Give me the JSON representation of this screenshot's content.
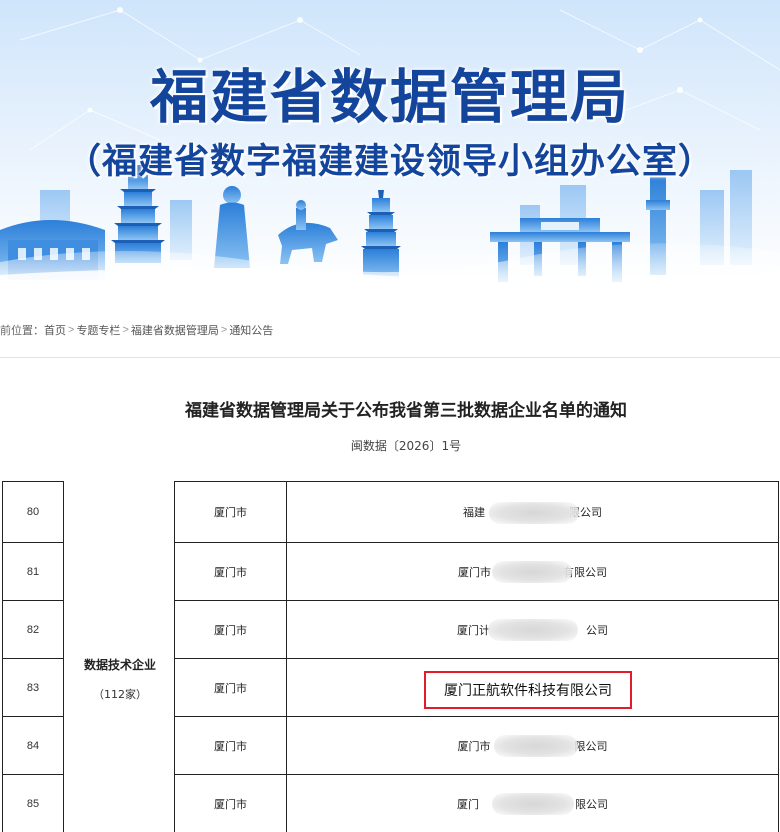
{
  "banner": {
    "title": "福建省数据管理局",
    "subtitle": "（福建省数字福建建设领导小组办公室）"
  },
  "breadcrumb": {
    "prefix": "前位置：",
    "items": [
      "首页",
      "专题专栏",
      "福建省数据管理局",
      "通知公告"
    ],
    "separator": ">"
  },
  "article": {
    "title": "福建省数据管理局关于公布我省第三批数据企业名单的通知",
    "doc_number": "闽数据〔2026〕1号"
  },
  "table": {
    "category": {
      "name": "数据技术企业",
      "count": "（112家）"
    },
    "rows": [
      {
        "no": "80",
        "city": "厦门市",
        "company_prefix": "福建",
        "company_suffix": "限公司",
        "redacted": true
      },
      {
        "no": "81",
        "city": "厦门市",
        "company_prefix": "厦门市",
        "company_suffix": "有限公司",
        "redacted": true
      },
      {
        "no": "82",
        "city": "厦门市",
        "company_prefix": "厦门计",
        "company_suffix": "公司",
        "redacted": true
      },
      {
        "no": "83",
        "city": "厦门市",
        "company": "厦门正航软件科技有限公司",
        "redacted": false,
        "highlighted": true
      },
      {
        "no": "84",
        "city": "厦门市",
        "company_prefix": "厦门市",
        "company_suffix": "限公司",
        "redacted": true
      },
      {
        "no": "85",
        "city": "厦门市",
        "company_prefix": "厦门",
        "company_suffix": "限公司",
        "redacted": true
      }
    ]
  },
  "colors": {
    "banner_title": "#13459c",
    "highlight_border": "#e21c2c"
  }
}
